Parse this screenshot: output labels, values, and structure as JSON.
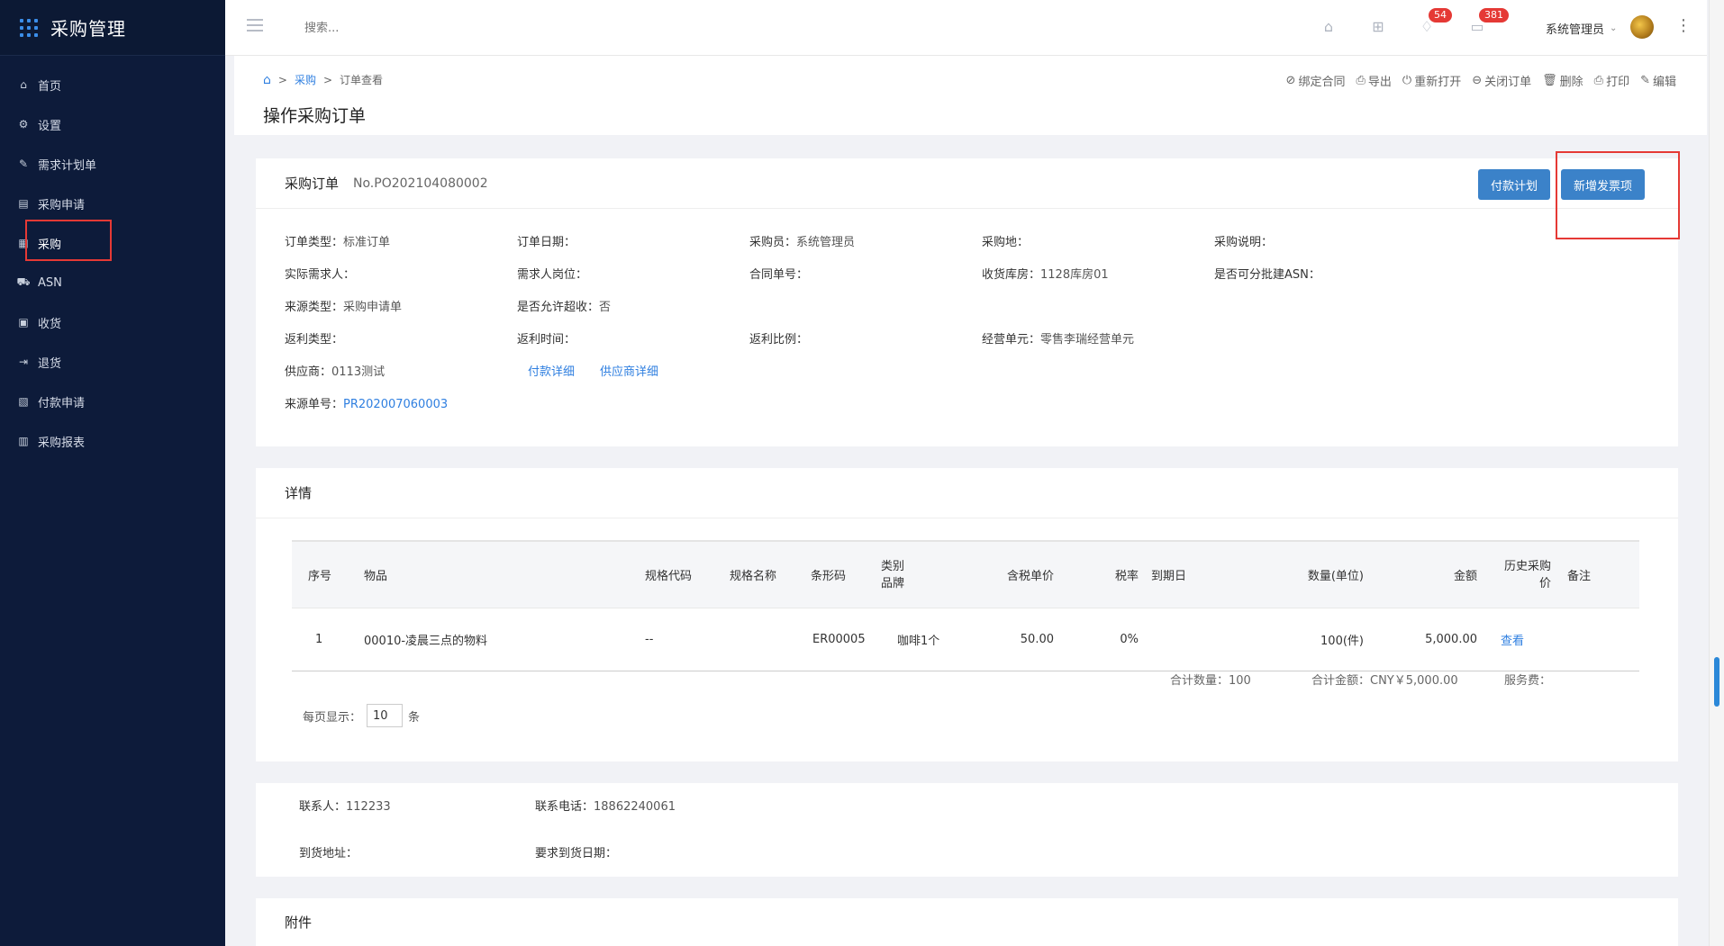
{
  "app": {
    "title": "采购管理"
  },
  "sidebar": {
    "items": [
      {
        "label": "首页",
        "icon": "home-icon"
      },
      {
        "label": "设置",
        "icon": "gear-icon"
      },
      {
        "label": "需求计划单",
        "icon": "edit-doc-icon"
      },
      {
        "label": "采购申请",
        "icon": "document-icon"
      },
      {
        "label": "采购",
        "icon": "list-doc-icon",
        "active": true
      },
      {
        "label": "ASN",
        "icon": "truck-icon"
      },
      {
        "label": "收货",
        "icon": "inbox-icon"
      },
      {
        "label": "退货",
        "icon": "exit-icon"
      },
      {
        "label": "付款申请",
        "icon": "payment-doc-icon"
      },
      {
        "label": "采购报表",
        "icon": "bar-chart-icon"
      }
    ]
  },
  "topbar": {
    "search_placeholder": "搜索...",
    "notifications_count": "54",
    "messages_count": "381",
    "user_name": "系统管理员"
  },
  "breadcrumb": {
    "level1": "采购",
    "level2": "订单查看"
  },
  "page_title": "操作采购订单",
  "actions": [
    "绑定合同",
    "导出",
    "重新打开",
    "关闭订单",
    "删除",
    "打印",
    "编辑"
  ],
  "order": {
    "heading": "采购订单",
    "number": "No.PO202104080002",
    "btn_payment_plan": "付款计划",
    "btn_add_invoice": "新增发票项",
    "fields": {
      "order_type_label": "订单类型：",
      "order_type": "标准订单",
      "order_date_label": "订单日期：",
      "buyer_label": "采购员：",
      "buyer": "系统管理员",
      "purchase_place_label": "采购地：",
      "purchase_note_label": "采购说明：",
      "actual_requester_label": "实际需求人：",
      "requester_post_label": "需求人岗位：",
      "contract_no_label": "合同单号：",
      "warehouse_label": "收货库房：",
      "warehouse": "1128库房01",
      "batch_asn_label": "是否可分批建ASN：",
      "source_type_label": "来源类型：",
      "source_type": "采购申请单",
      "over_receive_label": "是否允许超收：",
      "over_receive": "否",
      "rebate_type_label": "返利类型：",
      "rebate_time_label": "返利时间：",
      "rebate_ratio_label": "返利比例：",
      "business_unit_label": "经营单元：",
      "business_unit": "零售李瑞经营单元",
      "supplier_label": "供应商：",
      "supplier": "0113测试",
      "payment_detail_link": "付款详细",
      "supplier_detail_link": "供应商详细",
      "source_no_label": "来源单号：",
      "source_no": "PR202007060003"
    }
  },
  "details": {
    "heading": "详情",
    "columns": [
      "序号",
      "物品",
      "规格代码",
      "规格名称",
      "条形码",
      "类别品牌",
      "含税单价",
      "税率",
      "到期日",
      "数量(单位)",
      "金额",
      "历史采购价",
      "备注"
    ],
    "column_display": {
      "category_brand_line1": "类别",
      "category_brand_line2": "品牌",
      "history_line1": "历史采购",
      "history_line2": "价"
    },
    "rows": [
      {
        "seq": "1",
        "item": "00010-凌晨三点的物料",
        "spec_code": "--",
        "spec_name": "",
        "barcode": "ER00005",
        "category_brand": "咖啡1个",
        "unit_price": "50.00",
        "tax_rate": "0%",
        "due_date": "",
        "qty": "100(件)",
        "amount": "5,000.00",
        "history": "查看",
        "note": ""
      }
    ],
    "total_qty": "合计数量：100",
    "total_amount": "合计金额：CNY￥5,000.00",
    "service_fee": "服务费：",
    "per_page_label": "每页显示：",
    "per_page_value": "10",
    "per_page_unit": "条"
  },
  "contact": {
    "contact_label": "联系人：",
    "contact": "112233",
    "phone_label": "联系电话：",
    "phone": "18862240061",
    "address_label": "到货地址：",
    "required_date_label": "要求到货日期："
  },
  "attachments": {
    "heading": "附件"
  }
}
